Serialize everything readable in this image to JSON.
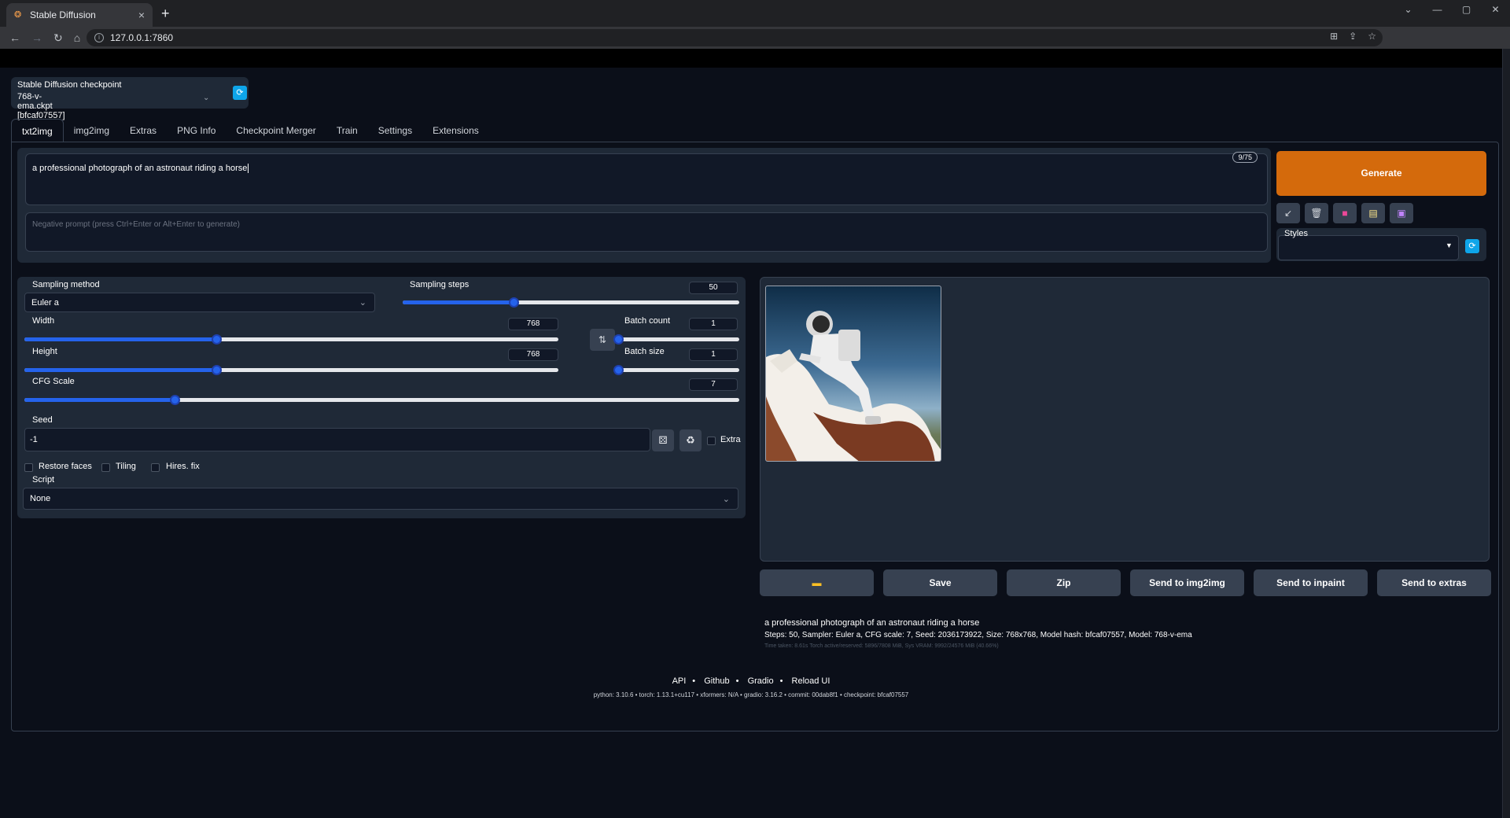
{
  "browser": {
    "tab_title": "Stable Diffusion",
    "url": "127.0.0.1:7860",
    "new_tab": "+",
    "close_tab": "×"
  },
  "checkpoint": {
    "label": "Stable Diffusion checkpoint",
    "value": "768-v-ema.ckpt [bfcaf07557]"
  },
  "tabs": [
    "txt2img",
    "img2img",
    "Extras",
    "PNG Info",
    "Checkpoint Merger",
    "Train",
    "Settings",
    "Extensions"
  ],
  "prompt": {
    "text": "a professional photograph of an astronaut riding a horse",
    "token_count": "9/75",
    "negative_placeholder": "Negative prompt (press Ctrl+Enter or Alt+Enter to generate)"
  },
  "generate_label": "Generate",
  "styles_label": "Styles",
  "sampling": {
    "method_label": "Sampling method",
    "method_value": "Euler a",
    "steps_label": "Sampling steps",
    "steps_value": "50",
    "steps_fraction": 0.33
  },
  "width": {
    "label": "Width",
    "value": "768",
    "fraction": 0.36
  },
  "height": {
    "label": "Height",
    "value": "768",
    "fraction": 0.36
  },
  "batch_count": {
    "label": "Batch count",
    "value": "1",
    "fraction": 0.0
  },
  "batch_size": {
    "label": "Batch size",
    "value": "1",
    "fraction": 0.0
  },
  "cfg": {
    "label": "CFG Scale",
    "value": "7",
    "fraction": 0.21
  },
  "seed": {
    "label": "Seed",
    "value": "-1",
    "extra_label": "Extra"
  },
  "checkboxes": {
    "restore_faces": "Restore faces",
    "tiling": "Tiling",
    "hires_fix": "Hires. fix"
  },
  "script": {
    "label": "Script",
    "value": "None"
  },
  "actions": [
    "Save",
    "Zip",
    "Send to img2img",
    "Send to inpaint",
    "Send to extras"
  ],
  "output_info": {
    "prompt": "a professional photograph of an astronaut riding a horse",
    "params": "Steps: 50, Sampler: Euler a, CFG scale: 7, Seed: 2036173922, Size: 768x768, Model hash: bfcaf07557, Model: 768-v-ema",
    "time": "Time taken: 8.61s  Torch active/reserved: 5896/7808 MiB, Sys VRAM: 9992/24576 MiB (40.66%)"
  },
  "footer": {
    "links": [
      "API",
      "Github",
      "Gradio",
      "Reload UI"
    ],
    "versions": "python: 3.10.6  •  torch: 1.13.1+cu117  •  xformers: N/A  •  gradio: 3.16.2  •  commit: 00dab8f1  •  checkpoint: bfcaf07557"
  }
}
